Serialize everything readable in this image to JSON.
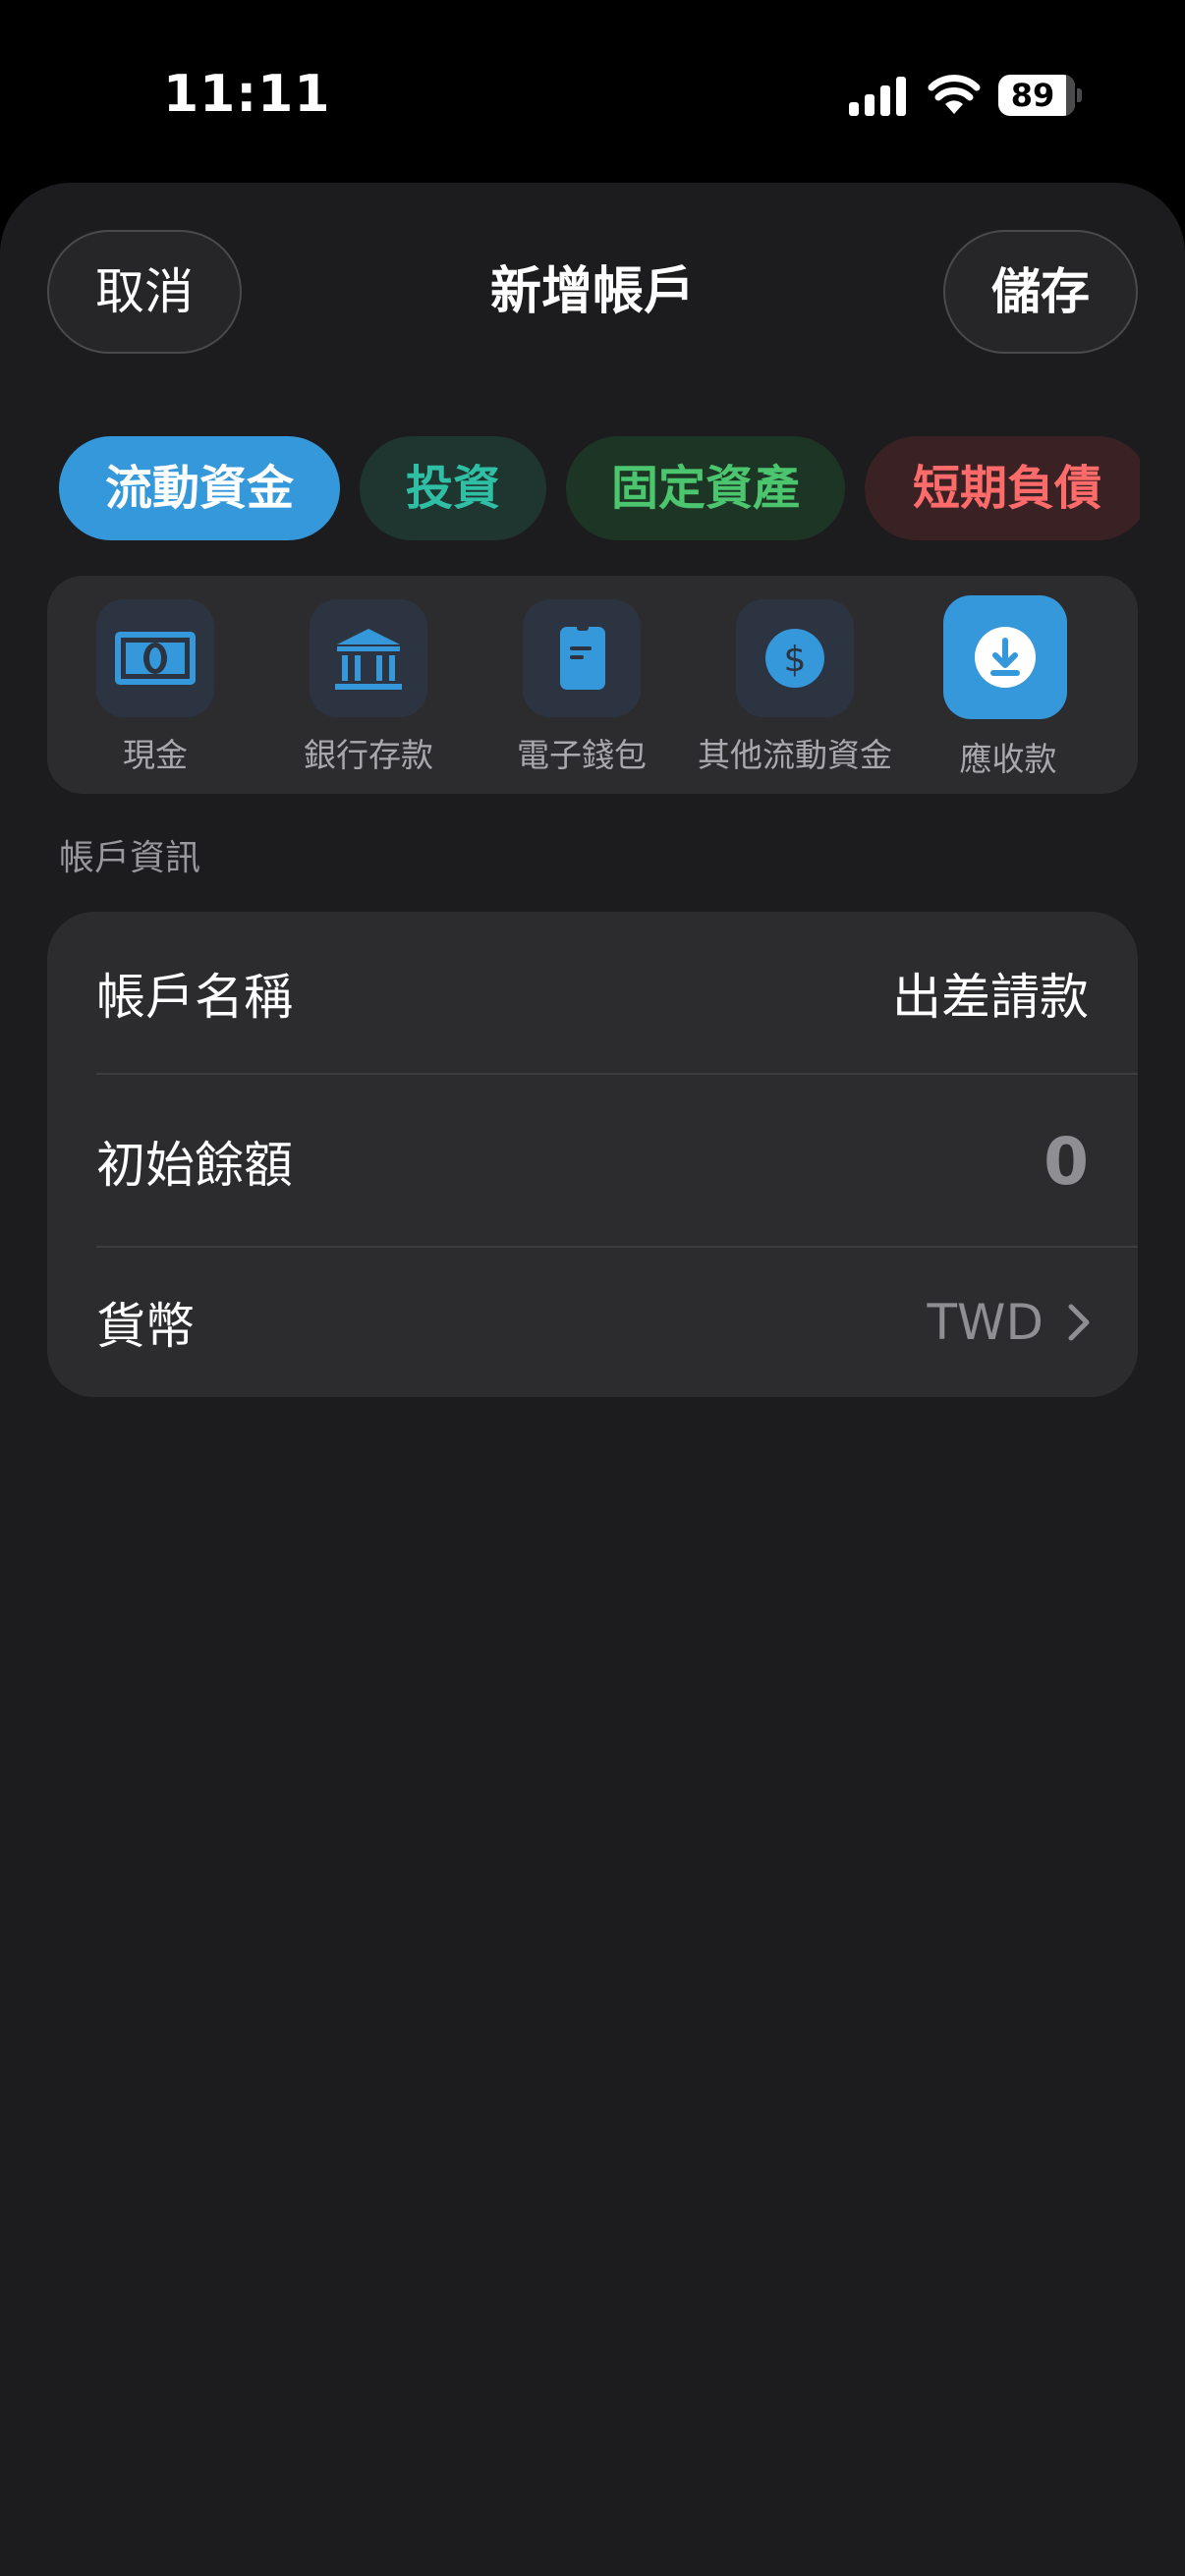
{
  "status_bar": {
    "time": "11:11",
    "battery_percent": "89",
    "icons": [
      "cellular-signal-icon",
      "wifi-icon",
      "battery-icon"
    ]
  },
  "header": {
    "cancel_label": "取消",
    "title": "新增帳戶",
    "save_label": "儲存"
  },
  "category_tabs": [
    {
      "label": "流動資金",
      "selected": true,
      "color": "#3498db"
    },
    {
      "label": "投資",
      "selected": false,
      "color": "#2fbfa4"
    },
    {
      "label": "固定資產",
      "selected": false,
      "color": "#4cc66e"
    },
    {
      "label": "短期負債",
      "selected": false,
      "color": "#ff6b6b"
    }
  ],
  "subtypes": [
    {
      "label": "現金",
      "icon": "cash-icon",
      "selected": false
    },
    {
      "label": "銀行存款",
      "icon": "bank-icon",
      "selected": false
    },
    {
      "label": "電子錢包",
      "icon": "e-wallet-icon",
      "selected": false
    },
    {
      "label": "其他流動資金",
      "icon": "dollar-circle-icon",
      "selected": false
    },
    {
      "label": "應收款",
      "icon": "download-circle-icon",
      "selected": true
    }
  ],
  "account_info": {
    "section_title": "帳戶資訊",
    "name_label": "帳戶名稱",
    "name_value": "出差請款",
    "balance_label": "初始餘額",
    "balance_value": "0",
    "currency_label": "貨幣",
    "currency_value": "TWD"
  },
  "colors": {
    "accent": "#3498db",
    "sheet_background": "#1c1c1e",
    "card_background": "#2c2c2e"
  }
}
